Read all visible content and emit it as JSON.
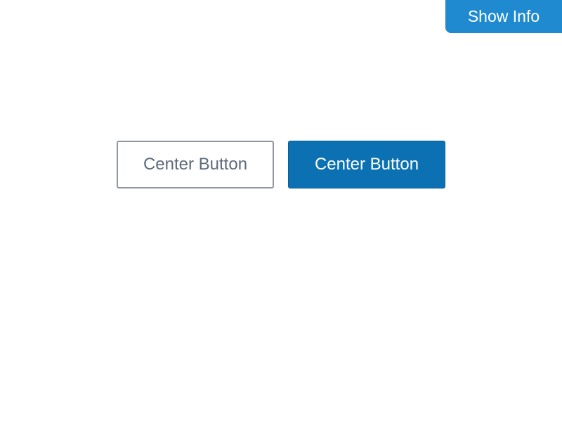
{
  "header": {
    "show_info_label": "Show Info"
  },
  "main": {
    "secondary_button_label": "Center Button",
    "primary_button_label": "Center Button"
  },
  "colors": {
    "show_info_bg": "#1f8ad0",
    "primary_bg": "#0b71b2",
    "outline_border": "#8f97a3",
    "outline_text": "#5e6a7d"
  }
}
